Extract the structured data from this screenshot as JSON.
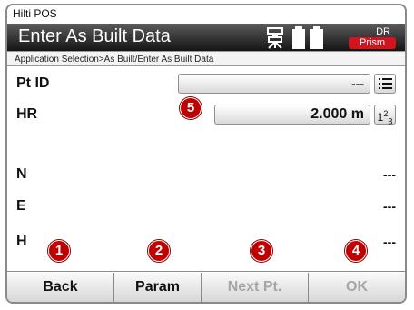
{
  "app": {
    "title": "Hilti POS"
  },
  "header": {
    "title": "Enter As Built Data",
    "mode_top": "DR",
    "mode_bottom": "Prism",
    "mode_color": "#d2141e"
  },
  "breadcrumb": "Application Selection>As Built/Enter As Built Data",
  "fields": {
    "pt_id": {
      "label": "Pt ID",
      "value": "---"
    },
    "hr": {
      "label": "HR",
      "value": "2.000 m"
    },
    "n": {
      "label": "N",
      "value": "---"
    },
    "e": {
      "label": "E",
      "value": "---"
    },
    "h": {
      "label": "H",
      "value": "---"
    }
  },
  "numeric_icon": {
    "base": "1",
    "sup": "2",
    "sub": "3"
  },
  "footer": {
    "back": "Back",
    "param": "Param",
    "next": "Next Pt.",
    "ok": "OK"
  },
  "markers": {
    "m1": "1",
    "m2": "2",
    "m3": "3",
    "m4": "4",
    "m5": "5"
  },
  "icons": {
    "list": "list-icon",
    "numeric": "numeric-keypad-icon",
    "instrument": "tribrach-icon",
    "battery": "battery-icon"
  }
}
